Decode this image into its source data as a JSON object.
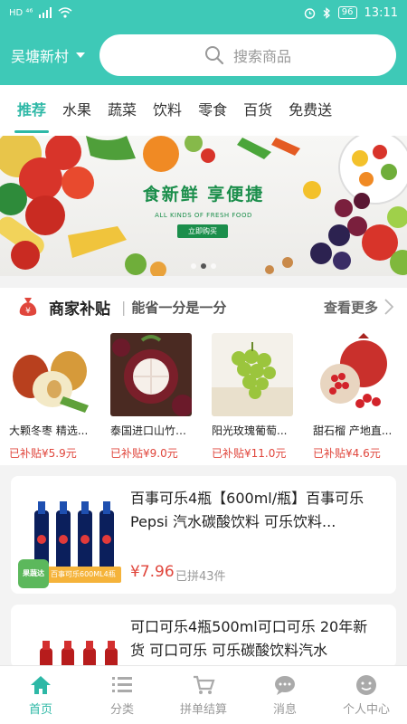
{
  "status_bar": {
    "network": "HD ⁴⁶",
    "battery": "96",
    "time": "13:11"
  },
  "header": {
    "location": "吴塘新村",
    "search_placeholder": "搜索商品"
  },
  "tabs": [
    "推荐",
    "水果",
    "蔬菜",
    "饮料",
    "零食",
    "百货",
    "免费送"
  ],
  "banner": {
    "title": "食新鲜 享便捷",
    "subtitle": "ALL KINDS OF FRESH FOOD",
    "button": "立即购买",
    "slide_count": 3,
    "active_slide": 2
  },
  "subsidy": {
    "title": "商家补贴",
    "slogan": "能省一分是一分",
    "more": "查看更多",
    "items": [
      {
        "name": "大颗冬枣 精选...",
        "price": "已补贴¥5.9元"
      },
      {
        "name": "泰国进口山竹5...",
        "price": "已补贴¥9.0元"
      },
      {
        "name": "阳光玫瑰葡萄...",
        "price": "已补贴¥11.0元"
      },
      {
        "name": "甜石榴 产地直...",
        "price": "已补贴¥4.6元"
      }
    ]
  },
  "products": [
    {
      "title": "百事可乐4瓶【600ml/瓶】百事可乐 Pepsi 汽水碳酸饮料 可乐饮料...",
      "price": "¥7.96",
      "sold": "已拼43件",
      "tag": "百事可乐600ML4瓶",
      "logo": "果蔬达"
    },
    {
      "title": "可口可乐4瓶500ml可口可乐 20年新货 可口可乐 可乐碳酸饮料汽水"
    }
  ],
  "bottom_nav": [
    {
      "label": "首页",
      "icon": "home-icon",
      "active": true
    },
    {
      "label": "分类",
      "icon": "list-icon",
      "active": false
    },
    {
      "label": "拼单结算",
      "icon": "cart-icon",
      "active": false
    },
    {
      "label": "消息",
      "icon": "message-icon",
      "active": false
    },
    {
      "label": "个人中心",
      "icon": "profile-icon",
      "active": false
    }
  ],
  "colors": {
    "brand": "#3ec9b7",
    "accent_text": "#2db8a6",
    "price": "#e0463c",
    "banner_green": "#1b8e4b"
  }
}
